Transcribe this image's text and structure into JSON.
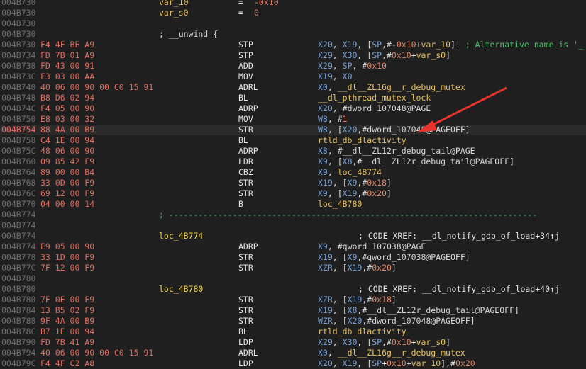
{
  "var_rows": [
    {
      "addr": "004B730",
      "name": "var_10",
      "eq": "=",
      "value": "-0x10"
    },
    {
      "addr": "004B730",
      "name": "var_s0",
      "eq": "=",
      "value": "0"
    }
  ],
  "blank_addr_1": "004B730",
  "unwind_row": {
    "addr": "004B730",
    "text": "; __unwind {"
  },
  "block1": [
    {
      "addr": "004B730",
      "bytes": "F4 4F BE A9",
      "mn": "STP",
      "ops": [
        [
          "reg",
          "X20"
        ],
        [
          "pun",
          ", "
        ],
        [
          "reg",
          "X19"
        ],
        [
          "pun",
          ", ["
        ],
        [
          "reg",
          "SP"
        ],
        [
          "pun",
          ",#-"
        ],
        [
          "num",
          "0x10"
        ],
        [
          "pun",
          "+"
        ],
        [
          "sym",
          "var_10"
        ],
        [
          "pun",
          "]! "
        ],
        [
          "cmtg",
          "; Alternative name is '_"
        ]
      ]
    },
    {
      "addr": "004B734",
      "bytes": "FD 7B 01 A9",
      "mn": "STP",
      "ops": [
        [
          "reg",
          "X29"
        ],
        [
          "pun",
          ", "
        ],
        [
          "reg",
          "X30"
        ],
        [
          "pun",
          ", ["
        ],
        [
          "reg",
          "SP"
        ],
        [
          "pun",
          ",#"
        ],
        [
          "num",
          "0x10"
        ],
        [
          "pun",
          "+"
        ],
        [
          "sym",
          "var_s0"
        ],
        [
          "pun",
          "]"
        ]
      ]
    },
    {
      "addr": "004B738",
      "bytes": "FD 43 00 91",
      "mn": "ADD",
      "ops": [
        [
          "reg",
          "X29"
        ],
        [
          "pun",
          ", "
        ],
        [
          "reg",
          "SP"
        ],
        [
          "pun",
          ", #"
        ],
        [
          "num",
          "0x10"
        ]
      ]
    },
    {
      "addr": "004B73C",
      "bytes": "F3 03 00 AA",
      "mn": "MOV",
      "ops": [
        [
          "reg",
          "X19"
        ],
        [
          "pun",
          ", "
        ],
        [
          "reg",
          "X0"
        ]
      ]
    },
    {
      "addr": "004B740",
      "bytes": "40 06 00 90 00 C0 15 91",
      "mn": "ADRL",
      "ops": [
        [
          "reg",
          "X0"
        ],
        [
          "pun",
          ", "
        ],
        [
          "sym",
          "__dl__ZL16g__r_debug_mutex"
        ]
      ]
    },
    {
      "addr": "004B748",
      "bytes": "B8 D6 02 94",
      "mn": "BL",
      "ops": [
        [
          "sym",
          "__dl_pthread_mutex_lock"
        ]
      ]
    },
    {
      "addr": "004B74C",
      "bytes": "F4 05 00 90",
      "mn": "ADRP",
      "ops": [
        [
          "reg",
          "X20"
        ],
        [
          "pun",
          ", #"
        ],
        [
          "ref",
          "dword_107048@PAGE"
        ]
      ]
    },
    {
      "addr": "004B750",
      "bytes": "E8 03 00 32",
      "mn": "MOV",
      "ops": [
        [
          "reg",
          "W8"
        ],
        [
          "pun",
          ", #"
        ],
        [
          "num",
          "1"
        ]
      ]
    },
    {
      "addr": "004B754",
      "bytes": "88 4A 00 B9",
      "mn": "STR",
      "current": true,
      "ops": [
        [
          "reg",
          "W8"
        ],
        [
          "pun",
          ", ["
        ],
        [
          "reg",
          "X20"
        ],
        [
          "pun",
          ",#"
        ],
        [
          "ref",
          "dword_107048@PAGEOFF"
        ],
        [
          "pun",
          "]"
        ]
      ]
    },
    {
      "addr": "004B758",
      "bytes": "C4 1E 00 94",
      "mn": "BL",
      "ops": [
        [
          "sym",
          "rtld_db_dlactivity"
        ]
      ]
    },
    {
      "addr": "004B75C",
      "bytes": "48 06 00 90",
      "mn": "ADRP",
      "ops": [
        [
          "reg",
          "X8"
        ],
        [
          "pun",
          ", #"
        ],
        [
          "ref",
          "__dl__ZL12r_debug_tail@PAGE"
        ]
      ]
    },
    {
      "addr": "004B760",
      "bytes": "09 85 42 F9",
      "mn": "LDR",
      "ops": [
        [
          "reg",
          "X9"
        ],
        [
          "pun",
          ", ["
        ],
        [
          "reg",
          "X8"
        ],
        [
          "pun",
          ",#"
        ],
        [
          "ref",
          "__dl__ZL12r_debug_tail@PAGEOFF"
        ],
        [
          "pun",
          "]"
        ]
      ]
    },
    {
      "addr": "004B764",
      "bytes": "89 00 00 B4",
      "mn": "CBZ",
      "ops": [
        [
          "reg",
          "X9"
        ],
        [
          "pun",
          ", "
        ],
        [
          "sym",
          "loc_4B774"
        ]
      ]
    },
    {
      "addr": "004B768",
      "bytes": "33 0D 00 F9",
      "mn": "STR",
      "ops": [
        [
          "reg",
          "X19"
        ],
        [
          "pun",
          ", ["
        ],
        [
          "reg",
          "X9"
        ],
        [
          "pun",
          ",#"
        ],
        [
          "num",
          "0x18"
        ],
        [
          "pun",
          "]"
        ]
      ]
    },
    {
      "addr": "004B76C",
      "bytes": "69 12 00 F9",
      "mn": "STR",
      "ops": [
        [
          "reg",
          "X9"
        ],
        [
          "pun",
          ", ["
        ],
        [
          "reg",
          "X19"
        ],
        [
          "pun",
          ",#"
        ],
        [
          "num",
          "0x20"
        ],
        [
          "pun",
          "]"
        ]
      ]
    },
    {
      "addr": "004B770",
      "bytes": "04 00 00 14",
      "mn": "B",
      "ops": [
        [
          "sym",
          "loc_4B780"
        ]
      ]
    }
  ],
  "separator_row": {
    "addr": "004B774",
    "text": "; ---------------------------------------------------------------------------"
  },
  "blank_addr_2": "004B774",
  "loc1": {
    "addr": "004B774",
    "label": "loc_4B774",
    "xref": "; CODE XREF: __dl_notify_gdb_of_load+34↑j"
  },
  "block2": [
    {
      "addr": "004B774",
      "bytes": "E9 05 00 90",
      "mn": "ADRP",
      "ops": [
        [
          "reg",
          "X9"
        ],
        [
          "pun",
          ", #"
        ],
        [
          "ref",
          "qword_107038@PAGE"
        ]
      ]
    },
    {
      "addr": "004B778",
      "bytes": "33 1D 00 F9",
      "mn": "STR",
      "ops": [
        [
          "reg",
          "X19"
        ],
        [
          "pun",
          ", ["
        ],
        [
          "reg",
          "X9"
        ],
        [
          "pun",
          ",#"
        ],
        [
          "ref",
          "qword_107038@PAGEOFF"
        ],
        [
          "pun",
          "]"
        ]
      ]
    },
    {
      "addr": "004B77C",
      "bytes": "7F 12 00 F9",
      "mn": "STR",
      "ops": [
        [
          "reg",
          "XZR"
        ],
        [
          "pun",
          ", ["
        ],
        [
          "reg",
          "X19"
        ],
        [
          "pun",
          ",#"
        ],
        [
          "num",
          "0x20"
        ],
        [
          "pun",
          "]"
        ]
      ]
    }
  ],
  "blank_addr_3": "004B780",
  "loc2": {
    "addr": "004B780",
    "label": "loc_4B780",
    "xref": "; CODE XREF: __dl_notify_gdb_of_load+40↑j"
  },
  "block3": [
    {
      "addr": "004B780",
      "bytes": "7F 0E 00 F9",
      "mn": "STR",
      "ops": [
        [
          "reg",
          "XZR"
        ],
        [
          "pun",
          ", ["
        ],
        [
          "reg",
          "X19"
        ],
        [
          "pun",
          ",#"
        ],
        [
          "num",
          "0x18"
        ],
        [
          "pun",
          "]"
        ]
      ]
    },
    {
      "addr": "004B784",
      "bytes": "13 B5 02 F9",
      "mn": "STR",
      "ops": [
        [
          "reg",
          "X19"
        ],
        [
          "pun",
          ", ["
        ],
        [
          "reg",
          "X8"
        ],
        [
          "pun",
          ",#"
        ],
        [
          "ref",
          "__dl__ZL12r_debug_tail@PAGEOFF"
        ],
        [
          "pun",
          "]"
        ]
      ]
    },
    {
      "addr": "004B788",
      "bytes": "9F 4A 00 B9",
      "mn": "STR",
      "ops": [
        [
          "reg",
          "WZR"
        ],
        [
          "pun",
          ", ["
        ],
        [
          "reg",
          "X20"
        ],
        [
          "pun",
          ",#"
        ],
        [
          "ref",
          "dword_107048@PAGEOFF"
        ],
        [
          "pun",
          "]"
        ]
      ]
    },
    {
      "addr": "004B78C",
      "bytes": "B7 1E 00 94",
      "mn": "BL",
      "ops": [
        [
          "sym",
          "rtld_db_dlactivity"
        ]
      ]
    },
    {
      "addr": "004B790",
      "bytes": "FD 7B 41 A9",
      "mn": "LDP",
      "ops": [
        [
          "reg",
          "X29"
        ],
        [
          "pun",
          ", "
        ],
        [
          "reg",
          "X30"
        ],
        [
          "pun",
          ", ["
        ],
        [
          "reg",
          "SP"
        ],
        [
          "pun",
          ",#"
        ],
        [
          "num",
          "0x10"
        ],
        [
          "pun",
          "+"
        ],
        [
          "sym",
          "var_s0"
        ],
        [
          "pun",
          "]"
        ]
      ]
    },
    {
      "addr": "004B794",
      "bytes": "40 06 00 90 00 C0 15 91",
      "mn": "ADRL",
      "ops": [
        [
          "reg",
          "X0"
        ],
        [
          "pun",
          ", "
        ],
        [
          "sym",
          "__dl__ZL16g__r_debug_mutex"
        ]
      ]
    },
    {
      "addr": "004B79C",
      "bytes": "F4 4F C2 A8",
      "mn": "LDP",
      "ops": [
        [
          "reg",
          "X20"
        ],
        [
          "pun",
          ", "
        ],
        [
          "reg",
          "X19"
        ],
        [
          "pun",
          ", ["
        ],
        [
          "reg",
          "SP"
        ],
        [
          "pun",
          "+"
        ],
        [
          "num",
          "0x10"
        ],
        [
          "pun",
          "+"
        ],
        [
          "sym",
          "var_10"
        ],
        [
          "pun",
          "],#"
        ],
        [
          "num",
          "0x20"
        ]
      ]
    }
  ],
  "colors": {
    "background": "#1f1f1f",
    "address": "#6d6d6d",
    "bytes": "#e06a5e",
    "register": "#7aa3d8",
    "label": "#f0d64c",
    "comment": "#4fbf6c",
    "arrow": "#e8322e"
  }
}
